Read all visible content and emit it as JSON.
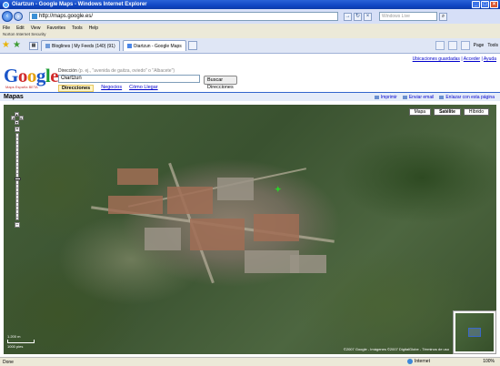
{
  "window": {
    "title": "Oiartzun - Google Maps - Windows Internet Explorer"
  },
  "browser": {
    "url": "http://maps.google.es/",
    "search_placeholder": "Windows Live",
    "menu": [
      "File",
      "Edit",
      "View",
      "Favorites",
      "Tools",
      "Help"
    ],
    "security_label": "Norton Internet Security",
    "tabs": [
      {
        "label": "Bloglines | My Feeds (140) (91)",
        "active": false
      },
      {
        "label": "Oiartzun - Google Maps",
        "active": true
      }
    ],
    "command_bar": {
      "page_label": "Page",
      "tools_label": "Tools"
    }
  },
  "page": {
    "top_links": {
      "saved": "Ubicaciones guardadas",
      "sep1": " | ",
      "signin": "Acceder",
      "sep2": " | ",
      "help": "Ayuda"
    },
    "logo": {
      "subtitle": "Maps España BETA"
    },
    "search": {
      "label": "Dirección",
      "hint": "(p. ej., \"avenida de gaitza, oviedo\" o \"Albacete\")",
      "value": "Oiartzun",
      "button": "Buscar Direcciones",
      "tabs": [
        "Direcciones",
        "Negocios",
        "Cómo Llegar"
      ]
    },
    "section_title": "Mapas",
    "map_links": {
      "print": "Imprimir",
      "email": "Enviar email",
      "link": "Enlazar con esta página"
    },
    "map": {
      "types": [
        "Mapa",
        "Satélite",
        "Híbrido"
      ],
      "active_type": "Satélite",
      "scale_top": "1.200 m",
      "scale_bottom": "1000 pies",
      "copyright": "©2007 Google - Imágenes ©2007 DigitalGlobe - Términos de uso"
    }
  },
  "statusbar": {
    "status": "Done",
    "zone": "Internet",
    "zoom": "100%"
  }
}
